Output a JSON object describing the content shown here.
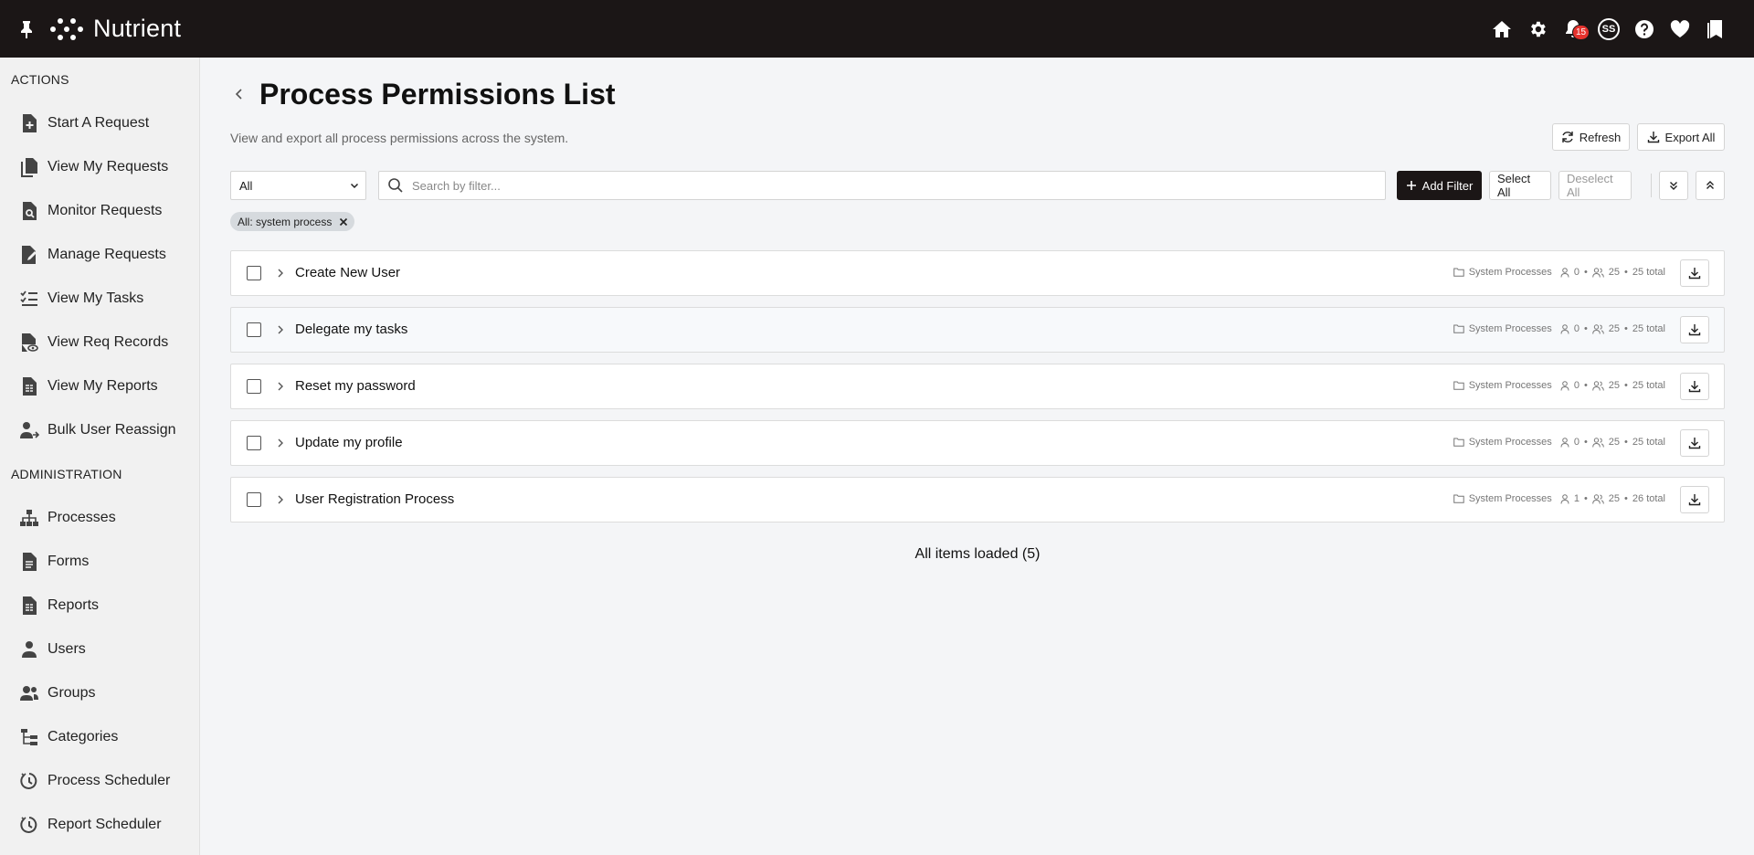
{
  "app": {
    "name": "Nutrient",
    "notification_count": "15",
    "user_initials": "SS"
  },
  "sidebar": {
    "actions_title": "ACTIONS",
    "actions": [
      {
        "label": "Start A Request",
        "icon": "file-plus-icon"
      },
      {
        "label": "View My Requests",
        "icon": "files-icon"
      },
      {
        "label": "Monitor Requests",
        "icon": "file-search-icon"
      },
      {
        "label": "Manage Requests",
        "icon": "file-edit-icon"
      },
      {
        "label": "View My Tasks",
        "icon": "task-list-icon"
      },
      {
        "label": "View Req Records",
        "icon": "file-eye-icon"
      },
      {
        "label": "View My Reports",
        "icon": "report-icon"
      },
      {
        "label": "Bulk User Reassign",
        "icon": "user-reassign-icon"
      }
    ],
    "admin_title": "ADMINISTRATION",
    "admin": [
      {
        "label": "Processes",
        "icon": "sitemap-icon"
      },
      {
        "label": "Forms",
        "icon": "form-icon"
      },
      {
        "label": "Reports",
        "icon": "report-icon"
      },
      {
        "label": "Users",
        "icon": "user-icon"
      },
      {
        "label": "Groups",
        "icon": "users-icon"
      },
      {
        "label": "Categories",
        "icon": "tree-icon"
      },
      {
        "label": "Process Scheduler",
        "icon": "clock-arrow-icon"
      },
      {
        "label": "Report Scheduler",
        "icon": "clock-arrow-icon"
      }
    ]
  },
  "page": {
    "title": "Process Permissions List",
    "subtitle": "View and export all process permissions across the system.",
    "refresh_label": "Refresh",
    "export_all_label": "Export All"
  },
  "filters": {
    "scope_value": "All",
    "search_placeholder": "Search by filter...",
    "add_filter_label": "Add Filter",
    "select_all_label": "Select All",
    "deselect_all_label": "Deselect All",
    "chip_label": "All: system process"
  },
  "rows": [
    {
      "name": "Create New User",
      "category": "System Processes",
      "users": "0",
      "groups": "25",
      "total": "25 total"
    },
    {
      "name": "Delegate my tasks",
      "category": "System Processes",
      "users": "0",
      "groups": "25",
      "total": "25 total"
    },
    {
      "name": "Reset my password",
      "category": "System Processes",
      "users": "0",
      "groups": "25",
      "total": "25 total"
    },
    {
      "name": "Update my profile",
      "category": "System Processes",
      "users": "0",
      "groups": "25",
      "total": "25 total"
    },
    {
      "name": "User Registration Process",
      "category": "System Processes",
      "users": "1",
      "groups": "25",
      "total": "26 total"
    }
  ],
  "status_text": "All items loaded (5)"
}
